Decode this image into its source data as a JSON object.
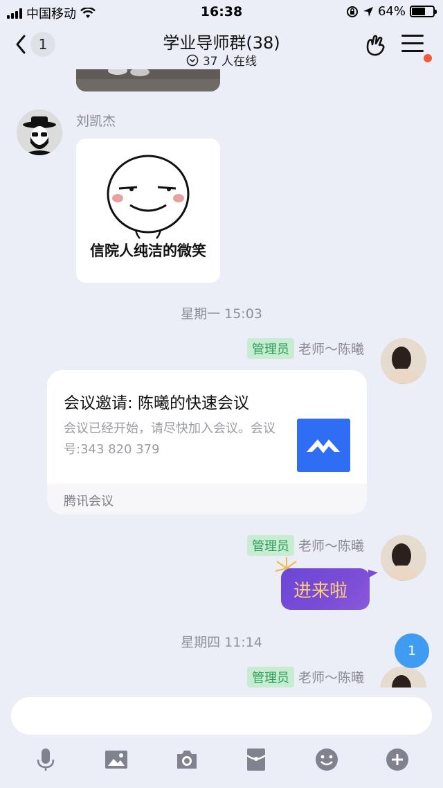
{
  "status_bar": {
    "carrier": "中国移动",
    "time": "16:38",
    "battery": "64%",
    "battery_level": 0.64
  },
  "nav": {
    "back_count": "1",
    "title": "学业导师群(38)",
    "online": "37 人在线"
  },
  "messages": {
    "sender1": "刘凯杰",
    "sticker_caption": "信院人纯洁的微笑",
    "timestamp1": "星期一 15:03",
    "admin_badge": "管理员",
    "admin_name": "老师～陈曦",
    "card_title": "会议邀请: 陈曦的快速会议",
    "card_desc": "会议已经开始，请尽快加入会议。会议号:343 820 379",
    "card_source": "腾讯会议",
    "bubble_text": "进来啦",
    "timestamp2": "星期四 11:14"
  },
  "unread": "1",
  "input": {
    "placeholder": ""
  },
  "toolbar": {
    "icons": [
      "microphone-icon",
      "image-icon",
      "camera-icon",
      "red-packet-icon",
      "emoji-icon",
      "plus-icon"
    ]
  }
}
